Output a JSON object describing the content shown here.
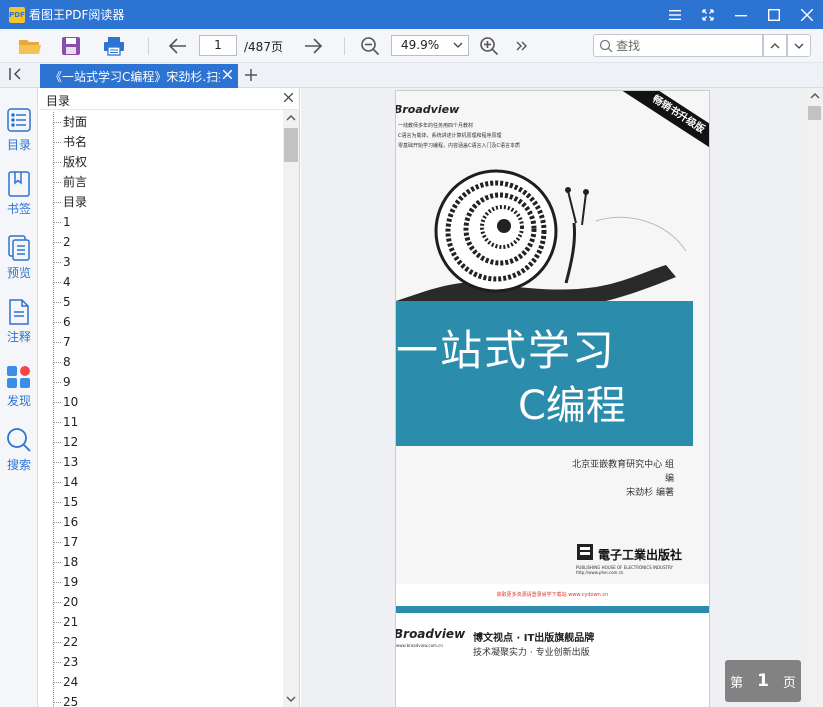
{
  "app": {
    "title": "看图王PDF阅读器",
    "logo_text": "PDF"
  },
  "toolbar": {
    "current_page": "1",
    "total_pages": "/487页",
    "zoom": "49.9%",
    "search_placeholder": "查找"
  },
  "tabs": [
    {
      "label": "《一站式学习C编程》宋劲杉.扫描版"
    }
  ],
  "leftnav": [
    {
      "label": "目录",
      "icon": "list-icon"
    },
    {
      "label": "书签",
      "icon": "bookmark-icon"
    },
    {
      "label": "预览",
      "icon": "pages-icon"
    },
    {
      "label": "注释",
      "icon": "annotation-icon"
    },
    {
      "label": "发现",
      "icon": "discover-icon"
    },
    {
      "label": "搜索",
      "icon": "search-icon"
    }
  ],
  "outline": {
    "title": "目录",
    "items": [
      "封面",
      "书名",
      "版权",
      "前言",
      "目录",
      "1",
      "2",
      "3",
      "4",
      "5",
      "6",
      "7",
      "8",
      "9",
      "10",
      "11",
      "12",
      "13",
      "14",
      "15",
      "16",
      "17",
      "18",
      "19",
      "20",
      "21",
      "22",
      "23",
      "24",
      "25"
    ]
  },
  "document": {
    "brand": "Broadview",
    "ribbon": "畅销书升级版",
    "blurbs": [
      "一线教师多年的任务用四个月教材",
      "C语言为载体，系统讲述计算机原理和程序原理",
      "零基础开始学习编程，内容涵盖C语言入门及C语言本质"
    ],
    "title_line1": "一站式学习",
    "title_line2": "C编程",
    "editor": "北京亚嵌教育研究中心  组编",
    "author": "宋劲杉  编著",
    "publisher": "電子工業出版社",
    "publisher_sub": "PUBLISHING HOUSE OF ELECTRONICS INDUSTRY  http://www.phei.com.cn",
    "promo": "获取更多资源请登录尚学下载站 www.cydown.cn",
    "inner_brand": "Broadview",
    "inner_brand_sub": "www.broadview.com.cn",
    "slogan1": "博文视点 · IT出版旗舰品牌",
    "slogan2": "技术凝聚实力 · 专业创新出版"
  },
  "page_indicator": {
    "prefix": "第",
    "page": "1",
    "suffix": "页"
  },
  "colors": {
    "accent": "#2d73d2",
    "cover_teal": "#2b8dab"
  }
}
